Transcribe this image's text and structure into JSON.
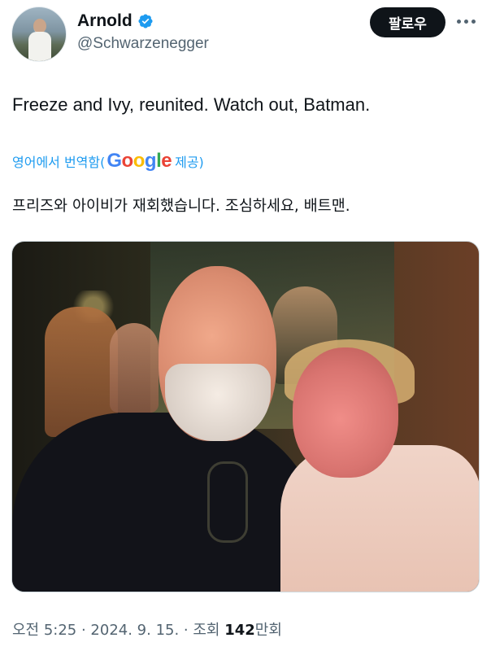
{
  "header": {
    "name": "Arnold",
    "handle": "@Schwarzenegger",
    "follow_label": "팔로우",
    "verified_color": "#1d9bf0"
  },
  "tweet": {
    "text": "Freeze and Ivy, reunited. Watch out, Batman.",
    "translate_prefix": "영어에서 번역함(",
    "translate_brand": "Google",
    "translate_suffix": " 제공)",
    "translated_text": "프리즈와 아이비가 재회했습니다. 조심하세요, 배트맨."
  },
  "meta": {
    "time_date": "오전 5:25 · 2024. 9. 15. · 조회 ",
    "views_number": "142",
    "views_unit": "만",
    "views_suffix": "회"
  },
  "colors": {
    "accent": "#1d9bf0",
    "text_primary": "#0f1419",
    "text_secondary": "#536471",
    "button_bg": "#0f1419"
  },
  "icons": [
    "verified-badge-icon",
    "more-options-icon"
  ]
}
